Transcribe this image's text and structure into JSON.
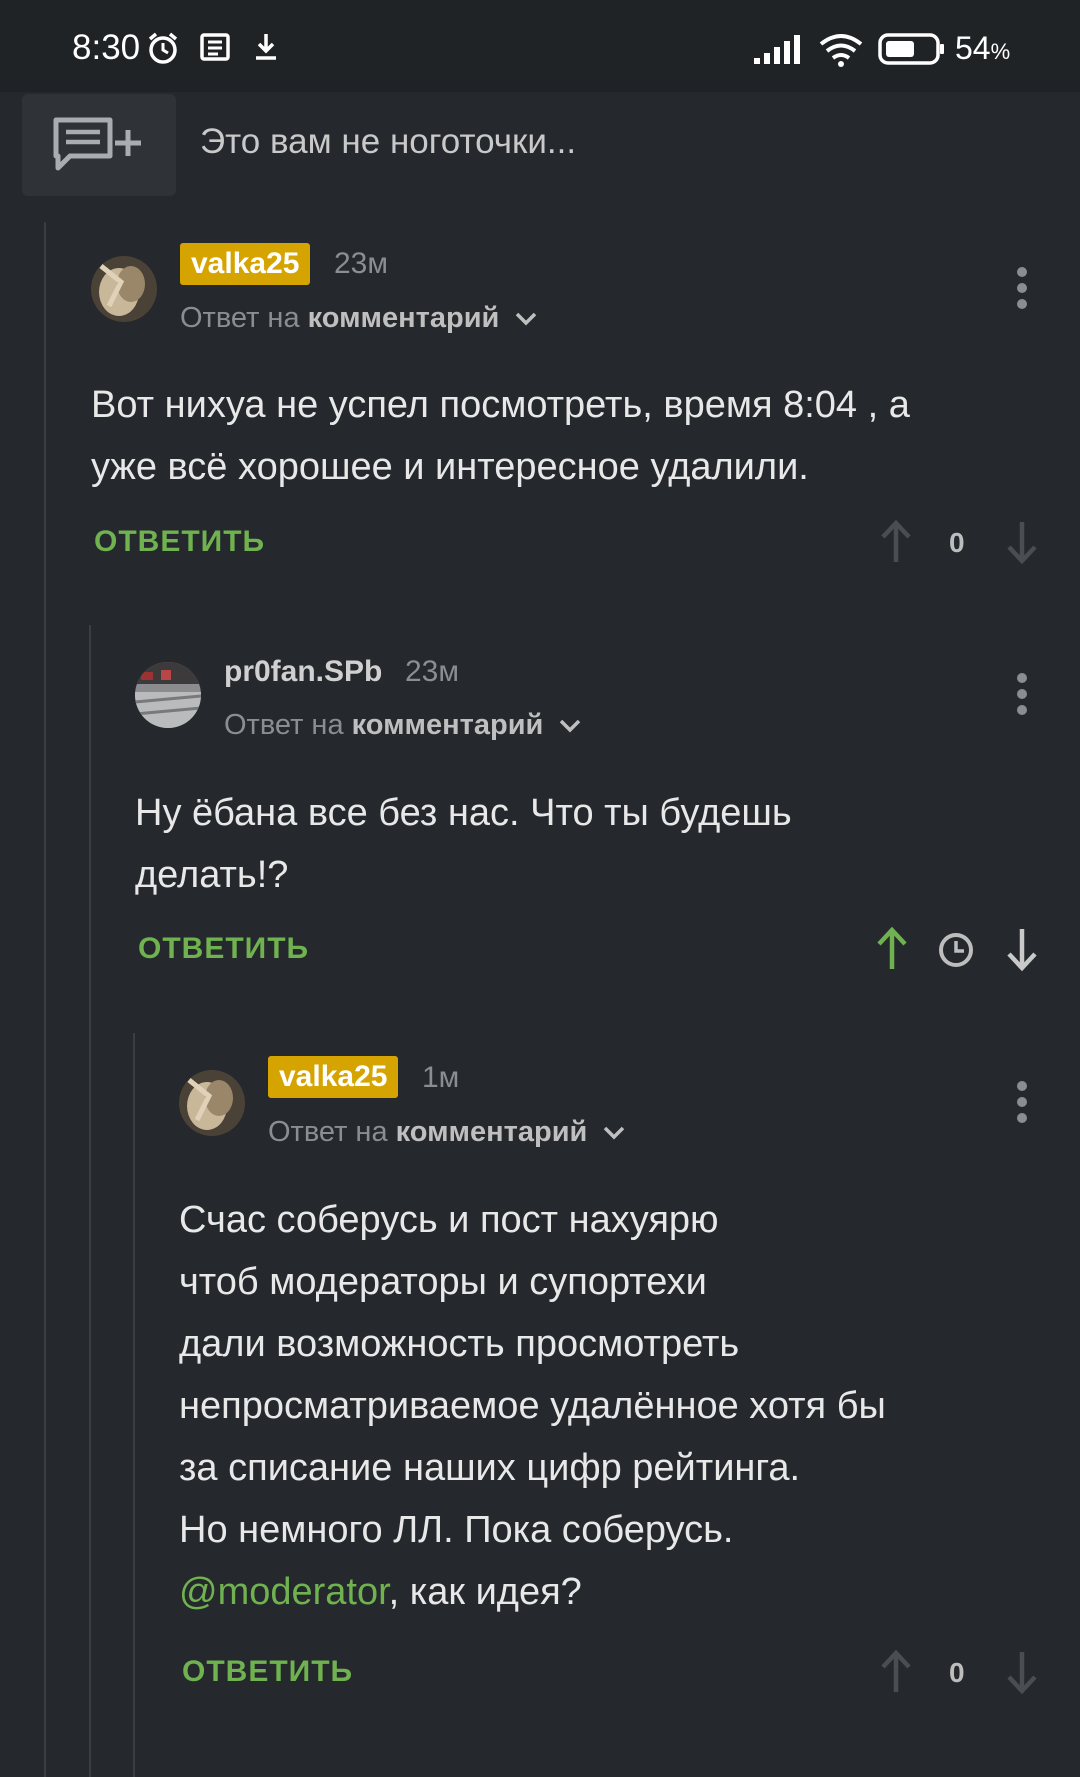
{
  "status_bar": {
    "time": "8:30",
    "icons": [
      "alarm-icon",
      "news-icon",
      "download-icon",
      "signal-icon",
      "wifi-icon",
      "battery-icon"
    ],
    "battery": "54",
    "battery_unit": "%"
  },
  "header": {
    "add_comment_icon": "add-comment-icon",
    "post_title": "Это вам не ноготочки..."
  },
  "colors": {
    "background": "#25282c",
    "accent_green": "#6fb24f",
    "badge_gold": "#d6a400",
    "muted": "#8a8d91"
  },
  "comments": [
    {
      "username": "valka25",
      "time": "23м",
      "reply_prefix": "Ответ на",
      "reply_target": "комментарий",
      "lines": [
        "Вот нихуа не успел посмотреть, время 8:04 , а",
        "уже всё хорошее и интересное удалили."
      ],
      "reply_label": "ОТВЕТИТЬ",
      "score": "0"
    },
    {
      "username": "pr0fan.SPb",
      "time": "23м",
      "reply_prefix": "Ответ на",
      "reply_target": "комментарий",
      "lines": [
        "Ну ёбана все без нас. Что ты будешь",
        "делать!?"
      ],
      "reply_label": "ОТВЕТИТЬ",
      "score_icon": "clock-icon"
    },
    {
      "username": "valka25",
      "time": "1м",
      "reply_prefix": "Ответ на",
      "reply_target": "комментарий",
      "lines": [
        "Счас соберусь и пост нахуярю",
        "чтоб модераторы и супортехи",
        "дали возможность просмотреть",
        "непросматриваемое удалённое хотя бы",
        "за списание наших цифр рейтинга.",
        "Но немного ЛЛ. Пока соберусь."
      ],
      "mention": "@moderator",
      "mention_rest": ", как идея?",
      "reply_label": "ОТВЕТИТЬ",
      "score": "0"
    }
  ]
}
